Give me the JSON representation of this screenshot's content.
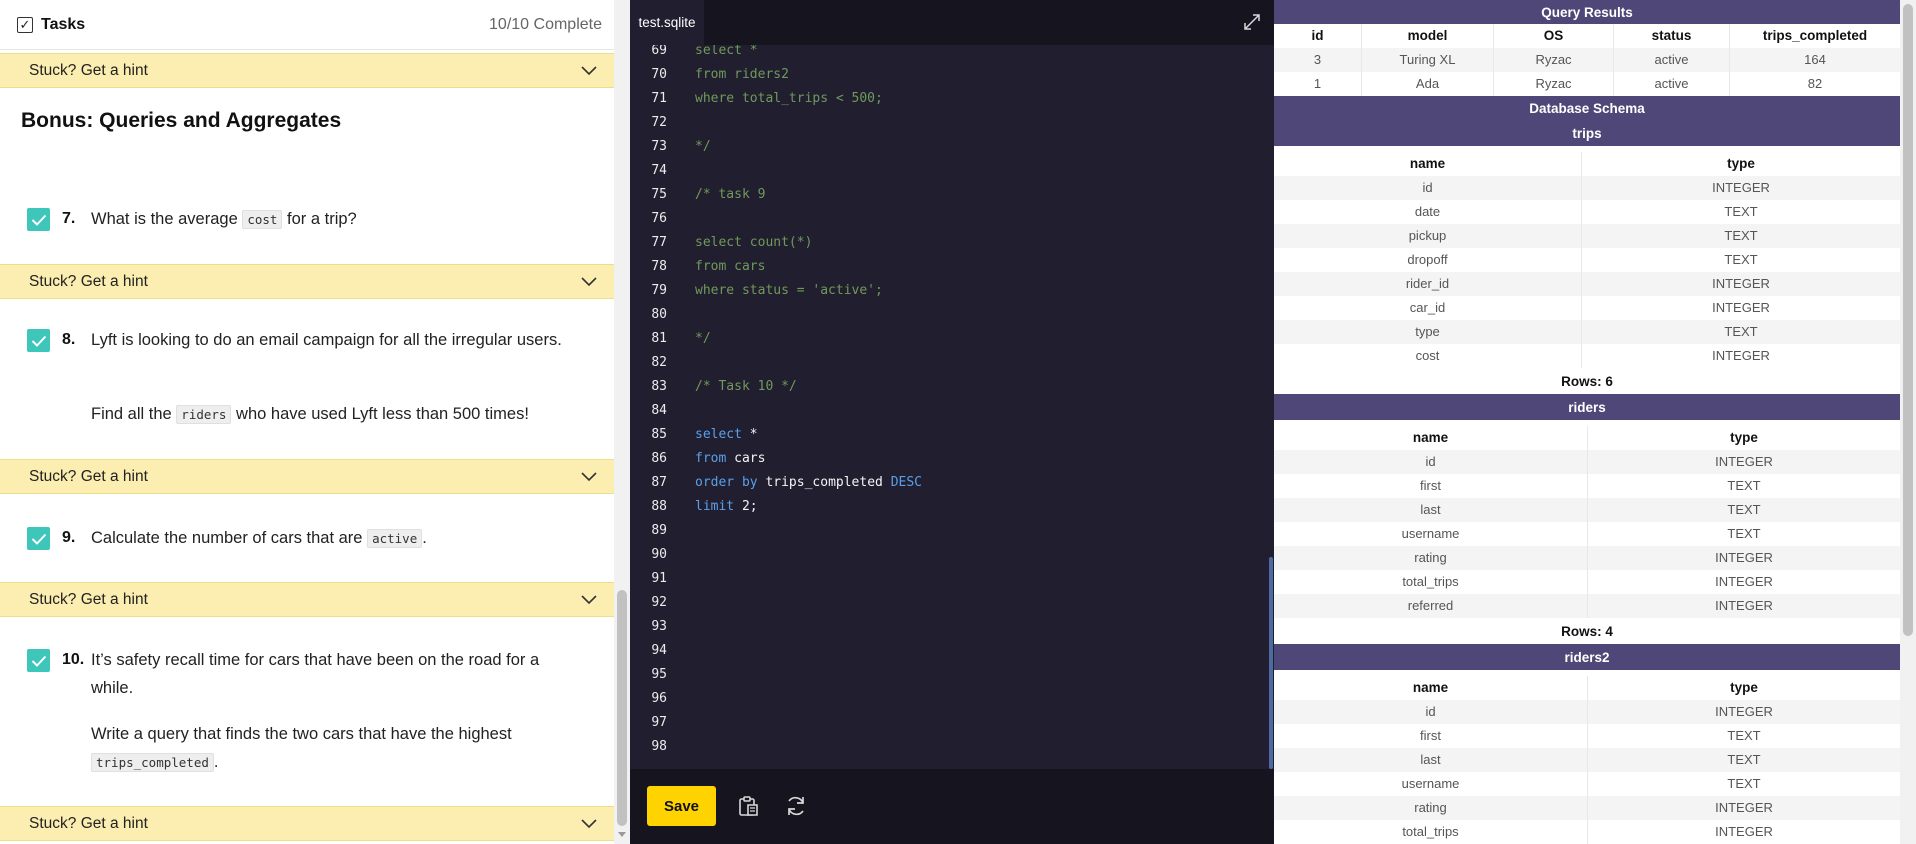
{
  "tasks_panel": {
    "title": "Tasks",
    "progress": "10/10 Complete",
    "hint_label": "Stuck? Get a hint",
    "section_title": "Bonus: Queries and Aggregates",
    "tasks": [
      {
        "number": "7.",
        "parts": [
          "What is the average ",
          "cost",
          " for a trip?"
        ]
      },
      {
        "number": "8.",
        "line1": "Lyft is looking to do an email campaign for all the irregular users.",
        "parts": [
          "Find all the ",
          "riders",
          " who have used Lyft less than 500 times!"
        ]
      },
      {
        "number": "9.",
        "parts": [
          "Calculate the number of cars that are ",
          "active",
          "."
        ]
      },
      {
        "number": "10.",
        "line1": "It’s safety recall time for cars that have been on the road for a while.",
        "parts": [
          "Write a query that finds the two cars that have the highest ",
          "trips_completed",
          "."
        ]
      }
    ]
  },
  "editor": {
    "tab_name": "test.sqlite",
    "save_label": "Save",
    "lines": [
      {
        "n": "69",
        "tokens": [
          {
            "t": "select *",
            "c": "comment"
          }
        ]
      },
      {
        "n": "70",
        "tokens": [
          {
            "t": "from riders2",
            "c": "comment"
          }
        ]
      },
      {
        "n": "71",
        "tokens": [
          {
            "t": "where total_trips < 500;",
            "c": "comment"
          }
        ]
      },
      {
        "n": "72",
        "tokens": []
      },
      {
        "n": "73",
        "tokens": [
          {
            "t": "*/",
            "c": "comment"
          }
        ]
      },
      {
        "n": "74",
        "tokens": []
      },
      {
        "n": "75",
        "tokens": [
          {
            "t": "/* task 9",
            "c": "comment"
          }
        ]
      },
      {
        "n": "76",
        "tokens": []
      },
      {
        "n": "77",
        "tokens": [
          {
            "t": "select count(*)",
            "c": "comment"
          }
        ]
      },
      {
        "n": "78",
        "tokens": [
          {
            "t": "from cars",
            "c": "comment"
          }
        ]
      },
      {
        "n": "79",
        "tokens": [
          {
            "t": "where status = 'active';",
            "c": "comment"
          }
        ]
      },
      {
        "n": "80",
        "tokens": []
      },
      {
        "n": "81",
        "tokens": [
          {
            "t": "*/",
            "c": "comment"
          }
        ]
      },
      {
        "n": "82",
        "tokens": []
      },
      {
        "n": "83",
        "tokens": [
          {
            "t": "/* Task 10 */",
            "c": "comment"
          }
        ]
      },
      {
        "n": "84",
        "tokens": []
      },
      {
        "n": "85",
        "tokens": [
          {
            "t": "select",
            "c": "kw"
          },
          {
            "t": " *",
            "c": "id"
          }
        ]
      },
      {
        "n": "86",
        "tokens": [
          {
            "t": "from",
            "c": "kw"
          },
          {
            "t": " cars",
            "c": "id"
          }
        ]
      },
      {
        "n": "87",
        "tokens": [
          {
            "t": "order by",
            "c": "kw"
          },
          {
            "t": " trips_completed ",
            "c": "id"
          },
          {
            "t": "DESC",
            "c": "kw"
          }
        ]
      },
      {
        "n": "88",
        "tokens": [
          {
            "t": "limit",
            "c": "kw"
          },
          {
            "t": " 2;",
            "c": "id"
          }
        ]
      },
      {
        "n": "89",
        "tokens": []
      },
      {
        "n": "90",
        "tokens": []
      },
      {
        "n": "91",
        "tokens": []
      },
      {
        "n": "92",
        "tokens": []
      },
      {
        "n": "93",
        "tokens": []
      },
      {
        "n": "94",
        "tokens": []
      },
      {
        "n": "95",
        "tokens": []
      },
      {
        "n": "96",
        "tokens": []
      },
      {
        "n": "97",
        "tokens": []
      },
      {
        "n": "98",
        "tokens": []
      }
    ]
  },
  "results": {
    "query_results_title": "Query Results",
    "columns": [
      "id",
      "model",
      "OS",
      "status",
      "trips_completed"
    ],
    "rows": [
      [
        "3",
        "Turing XL",
        "Ryzac",
        "active",
        "164"
      ],
      [
        "1",
        "Ada",
        "Ryzac",
        "active",
        "82"
      ]
    ],
    "schema_title": "Database Schema",
    "tables": [
      {
        "name": "trips",
        "header": [
          "name",
          "type"
        ],
        "fields": [
          [
            "id",
            "INTEGER"
          ],
          [
            "date",
            "TEXT"
          ],
          [
            "pickup",
            "TEXT"
          ],
          [
            "dropoff",
            "TEXT"
          ],
          [
            "rider_id",
            "INTEGER"
          ],
          [
            "car_id",
            "INTEGER"
          ],
          [
            "type",
            "TEXT"
          ],
          [
            "cost",
            "INTEGER"
          ]
        ],
        "rows_label": "Rows: 6"
      },
      {
        "name": "riders",
        "header": [
          "name",
          "type"
        ],
        "fields": [
          [
            "id",
            "INTEGER"
          ],
          [
            "first",
            "TEXT"
          ],
          [
            "last",
            "TEXT"
          ],
          [
            "username",
            "TEXT"
          ],
          [
            "rating",
            "INTEGER"
          ],
          [
            "total_trips",
            "INTEGER"
          ],
          [
            "referred",
            "INTEGER"
          ]
        ],
        "rows_label": "Rows: 4"
      },
      {
        "name": "riders2",
        "header": [
          "name",
          "type"
        ],
        "fields": [
          [
            "id",
            "INTEGER"
          ],
          [
            "first",
            "TEXT"
          ],
          [
            "last",
            "TEXT"
          ],
          [
            "username",
            "TEXT"
          ],
          [
            "rating",
            "INTEGER"
          ],
          [
            "total_trips",
            "INTEGER"
          ]
        ]
      }
    ]
  },
  "colors": {
    "hint_bg": "#fbeeb0",
    "check_teal": "#3ec6ba",
    "editor_bg": "#211e2f",
    "save_yellow": "#ffd300",
    "results_banner": "#4f4777"
  }
}
